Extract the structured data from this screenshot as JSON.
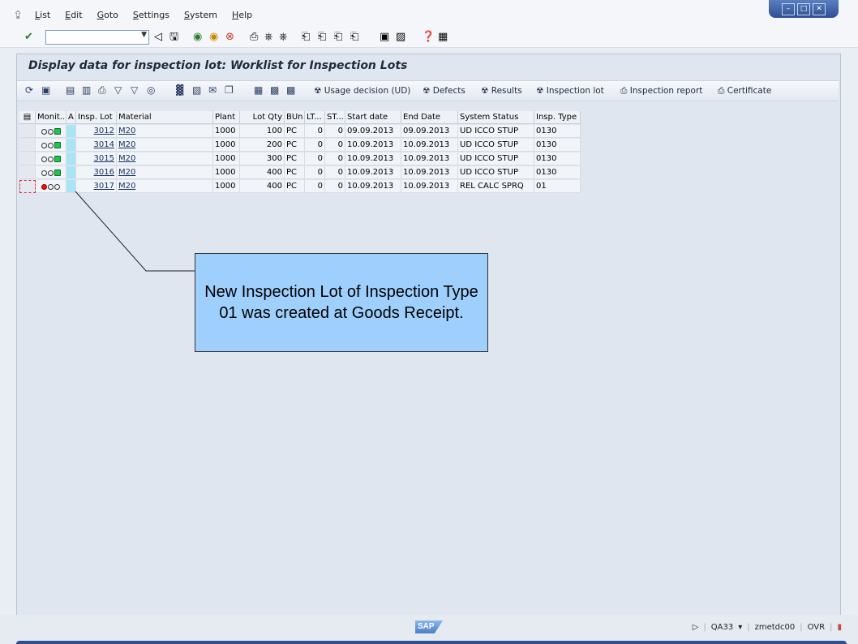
{
  "menu": [
    "List",
    "Edit",
    "Goto",
    "Settings",
    "System",
    "Help"
  ],
  "command_field": "",
  "title": "Display data for inspection lot: Worklist for Inspection Lots",
  "toolbar2_buttons": {
    "usage": "Usage decision (UD)",
    "defects": "Defects",
    "results": "Results",
    "lot": "Inspection lot",
    "report": "Inspection report",
    "cert": "Certificate"
  },
  "columns": [
    "Monit...",
    "A",
    "Insp. Lot",
    "Material",
    "Plant",
    "Lot Qty",
    "BUn",
    "LT...",
    "ST...",
    "Start date",
    "End Date",
    "System Status",
    "Insp. Type"
  ],
  "rows": [
    {
      "lights": "green",
      "lot": "3012",
      "material": "M20",
      "plant": "1000",
      "qty": "100",
      "bun": "PC",
      "lt": "0",
      "st": "0",
      "start": "09.09.2013",
      "end": "09.09.2013",
      "status": "UD  ICCO STUP",
      "type": "0130"
    },
    {
      "lights": "green",
      "lot": "3014",
      "material": "M20",
      "plant": "1000",
      "qty": "200",
      "bun": "PC",
      "lt": "0",
      "st": "0",
      "start": "10.09.2013",
      "end": "10.09.2013",
      "status": "UD  ICCO STUP",
      "type": "0130"
    },
    {
      "lights": "green",
      "lot": "3015",
      "material": "M20",
      "plant": "1000",
      "qty": "300",
      "bun": "PC",
      "lt": "0",
      "st": "0",
      "start": "10.09.2013",
      "end": "10.09.2013",
      "status": "UD  ICCO STUP",
      "type": "0130"
    },
    {
      "lights": "green",
      "lot": "3016",
      "material": "M20",
      "plant": "1000",
      "qty": "400",
      "bun": "PC",
      "lt": "0",
      "st": "0",
      "start": "10.09.2013",
      "end": "10.09.2013",
      "status": "UD  ICCO STUP",
      "type": "0130"
    },
    {
      "lights": "red",
      "lot": "3017",
      "material": "M20",
      "plant": "1000",
      "qty": "400",
      "bun": "PC",
      "lt": "0",
      "st": "0",
      "start": "10.09.2013",
      "end": "10.09.2013",
      "status": "REL  CALC SPRQ",
      "type": "01"
    }
  ],
  "callout": "New Inspection Lot of Inspection Type 01 was created at Goods Receipt.",
  "statusbar": {
    "logo": "SAP",
    "tcode": "QA33",
    "server": "zmetdc00",
    "mode": "OVR"
  }
}
